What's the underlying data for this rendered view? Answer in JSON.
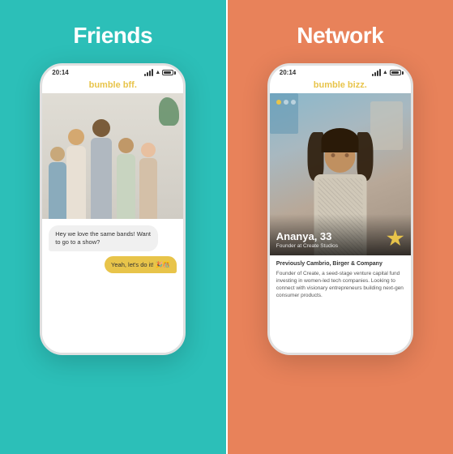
{
  "panels": {
    "left": {
      "title": "Friends",
      "bg_color": "#2CBFB8",
      "app_name": "bumble bff.",
      "status_time": "20:14",
      "chat": {
        "received": "Hey we love the same bands! Want to go to a show?",
        "sent": "Yeah, let's do it! 🎉🎊"
      }
    },
    "right": {
      "title": "Network",
      "bg_color": "#E8825A",
      "app_name": "bumble bizz.",
      "status_time": "20:14",
      "profile": {
        "name": "Ananya, 33",
        "title": "Founder at Create Studios",
        "subtitle": "Previously Cambrio, Birger & Company",
        "bio": "Founder of Create, a seed-stage venture capital fund investing in women-led tech companies. Looking to connect with visionary entrepreneurs building next-gen consumer products."
      }
    }
  }
}
